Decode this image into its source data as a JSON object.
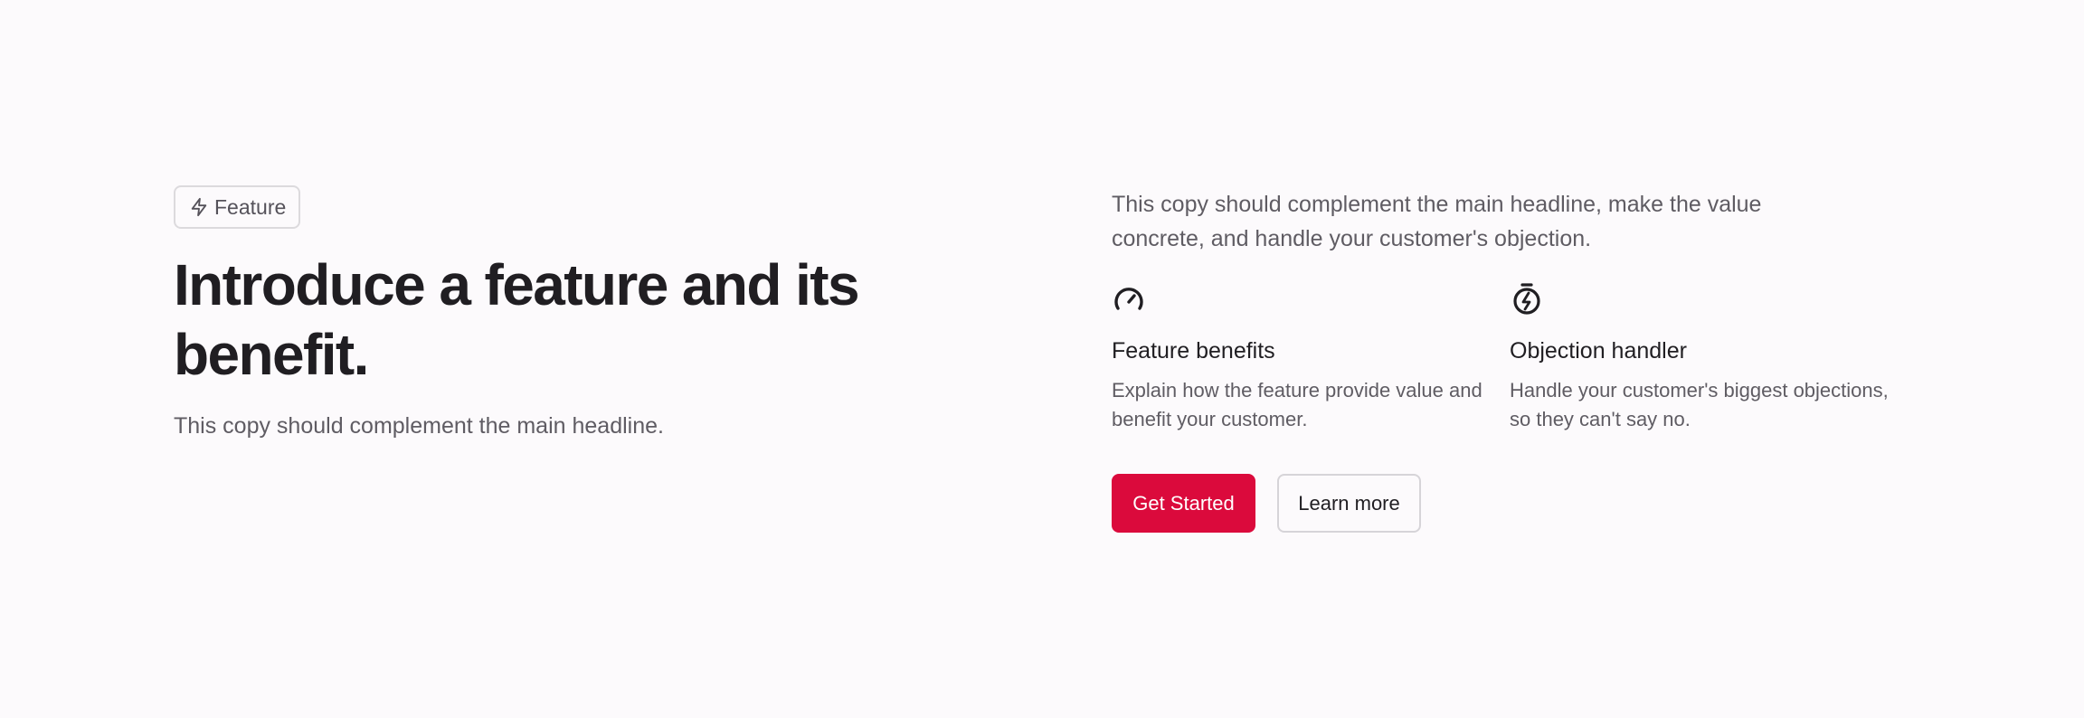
{
  "badge": {
    "icon": "lightning-icon",
    "label": "Feature"
  },
  "hero": {
    "headline": "Introduce a feature and its benefit.",
    "subtitle": "This copy should complement the main headline."
  },
  "details": {
    "intro": "This copy should complement the main headline, make the value concrete, and handle your customer's objection.",
    "features": [
      {
        "icon": "gauge-icon",
        "title": "Feature benefits",
        "description": "Explain how the feature provide value and benefit your customer."
      },
      {
        "icon": "stopwatch-bolt-icon",
        "title": "Objection handler",
        "description": "Handle your customer's biggest objections, so they can't say no."
      }
    ]
  },
  "actions": {
    "primary_label": "Get Started",
    "secondary_label": "Learn more"
  },
  "colors": {
    "accent": "#db0a3c",
    "background": "#fcfafc",
    "heading": "#201e22",
    "body_text": "#5f5c63",
    "border": "#d6d4d8"
  }
}
